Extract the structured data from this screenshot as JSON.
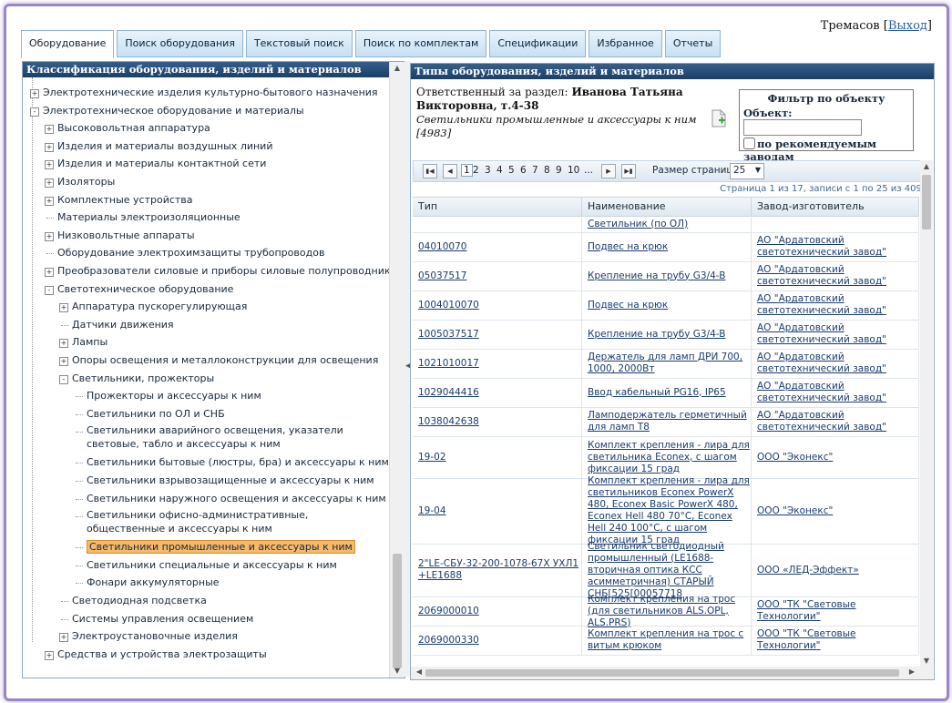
{
  "user": {
    "name": "Тремасов",
    "logout": "Выход"
  },
  "tabs": [
    "Оборудование",
    "Поиск оборудования",
    "Текстовый поиск",
    "Поиск по комплектам",
    "Спецификации",
    "Избранное",
    "Отчеты"
  ],
  "left_panel": {
    "title": "Классификация оборудования, изделий и материалов",
    "tree": [
      {
        "label": "Электротехнические изделия культурно-бытового назначения",
        "level": 0,
        "expander": "+"
      },
      {
        "label": "Электротехническое оборудование и материалы",
        "level": 0,
        "expander": "-"
      },
      {
        "label": "Высоковольтная аппаратура",
        "level": 1,
        "expander": "+"
      },
      {
        "label": "Изделия и материалы воздушных линий",
        "level": 1,
        "expander": "+"
      },
      {
        "label": "Изделия и материалы контактной сети",
        "level": 1,
        "expander": "+"
      },
      {
        "label": "Изоляторы",
        "level": 1,
        "expander": "+"
      },
      {
        "label": "Комплектные устройства",
        "level": 1,
        "expander": "+"
      },
      {
        "label": "Материалы электроизоляционные",
        "level": 1,
        "expander": ""
      },
      {
        "label": "Низковольтные аппараты",
        "level": 1,
        "expander": "+"
      },
      {
        "label": "Оборудование электрохимзащиты трубопроводов",
        "level": 1,
        "expander": ""
      },
      {
        "label": "Преобразователи силовые и приборы силовые полупроводниковые",
        "level": 1,
        "expander": "+"
      },
      {
        "label": "Светотехническое оборудование",
        "level": 1,
        "expander": "-"
      },
      {
        "label": "Аппаратура пускорегулирующая",
        "level": 2,
        "expander": "+"
      },
      {
        "label": "Датчики движения",
        "level": 2,
        "expander": ""
      },
      {
        "label": "Лампы",
        "level": 2,
        "expander": "+"
      },
      {
        "label": "Опоры освещения и металлоконструкции для освещения",
        "level": 2,
        "expander": "+"
      },
      {
        "label": "Светильники, прожекторы",
        "level": 2,
        "expander": "-"
      },
      {
        "label": "Прожекторы и аксессуары к ним",
        "level": 3,
        "expander": ""
      },
      {
        "label": "Светильники по ОЛ и СНБ",
        "level": 3,
        "expander": ""
      },
      {
        "label": "Светильники аварийного освещения, указатели световые, табло и аксессуары к ним",
        "level": 3,
        "expander": "",
        "wrap": true
      },
      {
        "label": "Светильники бытовые (люстры, бра) и аксессуары к ним",
        "level": 3,
        "expander": ""
      },
      {
        "label": "Светильники взрывозащищенные и аксессуары к ним",
        "level": 3,
        "expander": ""
      },
      {
        "label": "Светильники наружного освещения и аксессуары к ним",
        "level": 3,
        "expander": ""
      },
      {
        "label": "Светильники офисно-административные, общественные и аксессуары к ним",
        "level": 3,
        "expander": "",
        "wrap": true
      },
      {
        "label": "Светильники промышленные и аксессуары к ним",
        "level": 3,
        "expander": "",
        "selected": true
      },
      {
        "label": "Светильники специальные и аксессуары к ним",
        "level": 3,
        "expander": ""
      },
      {
        "label": "Фонари аккумуляторные",
        "level": 3,
        "expander": ""
      },
      {
        "label": "Светодиодная подсветка",
        "level": 2,
        "expander": ""
      },
      {
        "label": "Системы управления освещением",
        "level": 2,
        "expander": ""
      },
      {
        "label": "Электроустановочные изделия",
        "level": 2,
        "expander": "+"
      },
      {
        "label": "Средства и устройства электрозащиты",
        "level": 1,
        "expander": "+"
      }
    ]
  },
  "right_panel": {
    "title": "Типы оборудования, изделий и материалов",
    "responsible_label": "Ответственный за раздел:",
    "responsible_name": "Иванова Татьяна Викторовна, т.4-38",
    "section": "Светильники промышленные и аксессуары к ним [4983]",
    "filter": {
      "title": "Фильтр по объекту",
      "object_label": "Объект:",
      "object_value": "",
      "checkbox_label": "по рекомендуемым заводам"
    },
    "pager": {
      "pages": [
        "1",
        "2",
        "3",
        "4",
        "5",
        "6",
        "7",
        "8",
        "9",
        "10",
        "..."
      ],
      "current": "1",
      "page_size_label": "Размер страницы:",
      "page_size": "25"
    },
    "page_info": "Страница 1 из 17, записи с 1 по 25 из 409.",
    "columns": [
      "Тип",
      "Наименование",
      "Завод-изготовитель"
    ],
    "rows": [
      {
        "type": "",
        "name": "Светильник (по ОЛ)",
        "maker": ""
      },
      {
        "type": "04010070",
        "name": "Подвес на крюк",
        "maker": "АО \"Ардатовский светотехнический завод\""
      },
      {
        "type": "05037517",
        "name": "Крепление на трубу G3/4-B",
        "maker": "АО \"Ардатовский светотехнический завод\""
      },
      {
        "type": "1004010070",
        "name": "Подвес на крюк",
        "maker": "АО \"Ардатовский светотехнический завод\""
      },
      {
        "type": "1005037517",
        "name": "Крепление на трубу G3/4-B",
        "maker": "АО \"Ардатовский светотехнический завод\""
      },
      {
        "type": "1021010017",
        "name": "Держатель для ламп ДРИ 700, 1000, 2000Вт",
        "maker": "АО \"Ардатовский светотехнический завод\""
      },
      {
        "type": "1029044416",
        "name": "Ввод кабельный PG16, IP65",
        "maker": "АО \"Ардатовский светотехнический завод\""
      },
      {
        "type": "1038042638",
        "name": "Ламподержатель герметичный для ламп Т8",
        "maker": "АО \"Ардатовский светотехнический завод\""
      },
      {
        "type": "19-02",
        "name": "Комплект крепления - лира для светильника Econex, с шагом фиксации 15 град",
        "maker": "ООО \"Эконекс\""
      },
      {
        "type": "19-04",
        "name": "Комплект крепления - лира для светильников Econex PowerX 480, Econex Basic PowerX 480, Econex Hell 480 70°C, Econex Hell 240 100°C, с шагом фиксации 15 град",
        "maker": "ООО \"Эконекс\""
      },
      {
        "type": "2\"LE-СБУ-32-200-1078-67Х УХЛ1 +LE1688",
        "name": "Светильник светодиодный промышленный (LE1688-вторичная оптика КСС асимметричная) СТАРЫЙ СНБ[525[00057718",
        "maker": "ООО «ЛЕД-Эффект»"
      },
      {
        "type": "2069000010",
        "name": "Комплект крепления на трос (для светильников ALS.OPL, ALS.PRS)",
        "maker": "ООО \"ТК \"Световые Технологии\""
      },
      {
        "type": "2069000330",
        "name": "Комплект крепления на трос с витым крюком",
        "maker": "ООО \"ТК \"Световые Технологии\""
      }
    ]
  }
}
